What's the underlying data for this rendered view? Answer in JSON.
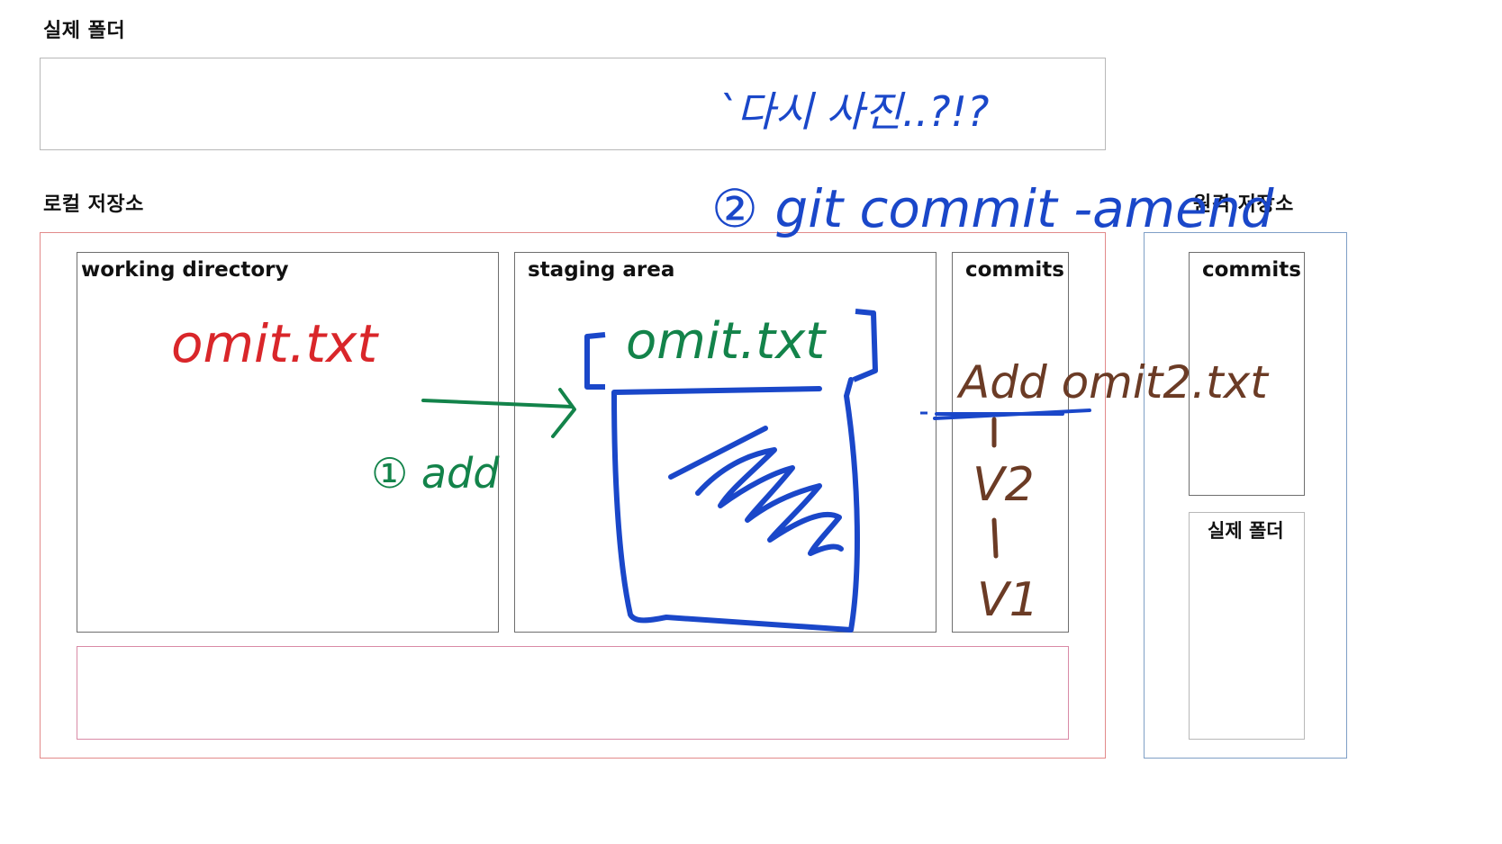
{
  "headings": {
    "real_folder": "실제 폴더",
    "local_repo": "로컬 저장소",
    "remote_repo": "원격 저장소"
  },
  "local": {
    "working_directory": "working directory",
    "staging_area": "staging area",
    "commits": "commits"
  },
  "remote": {
    "commits": "commits",
    "real_folder": "실제 폴더"
  },
  "annotations": {
    "memo": "`다시 사진..?!?",
    "step2": "② git commit -amend",
    "red_file": "omit.txt",
    "step1": "① add",
    "staged_file": "omit.txt",
    "commit_msg": "Add omit2.txt",
    "v2": "V2",
    "v1": "V1"
  },
  "colors": {
    "red_ink": "#d9262a",
    "green_ink": "#13834a",
    "blue_ink": "#1a47c9",
    "brown_ink": "#6b3b25"
  }
}
